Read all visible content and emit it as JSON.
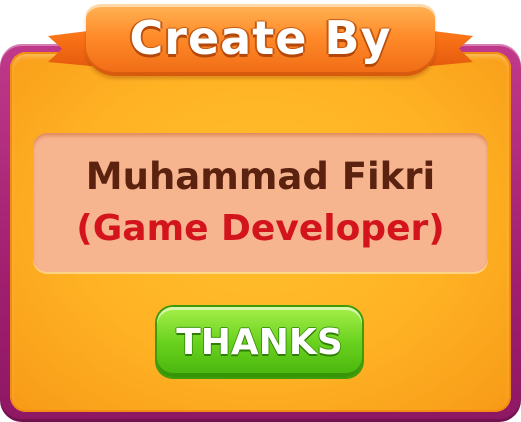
{
  "dialog": {
    "title": "Create By",
    "developer_name": "Muhammad Fikri",
    "developer_role": "(Game Developer)",
    "thanks_label": "THANKS"
  },
  "colors": {
    "frame": "#a1206f",
    "panel": "#ffb224",
    "ribbon": "#ff8b2a",
    "info_box": "#f7b58f",
    "name_text": "#5c2210",
    "role_text": "#d3141c",
    "button": "#6ad21f"
  }
}
